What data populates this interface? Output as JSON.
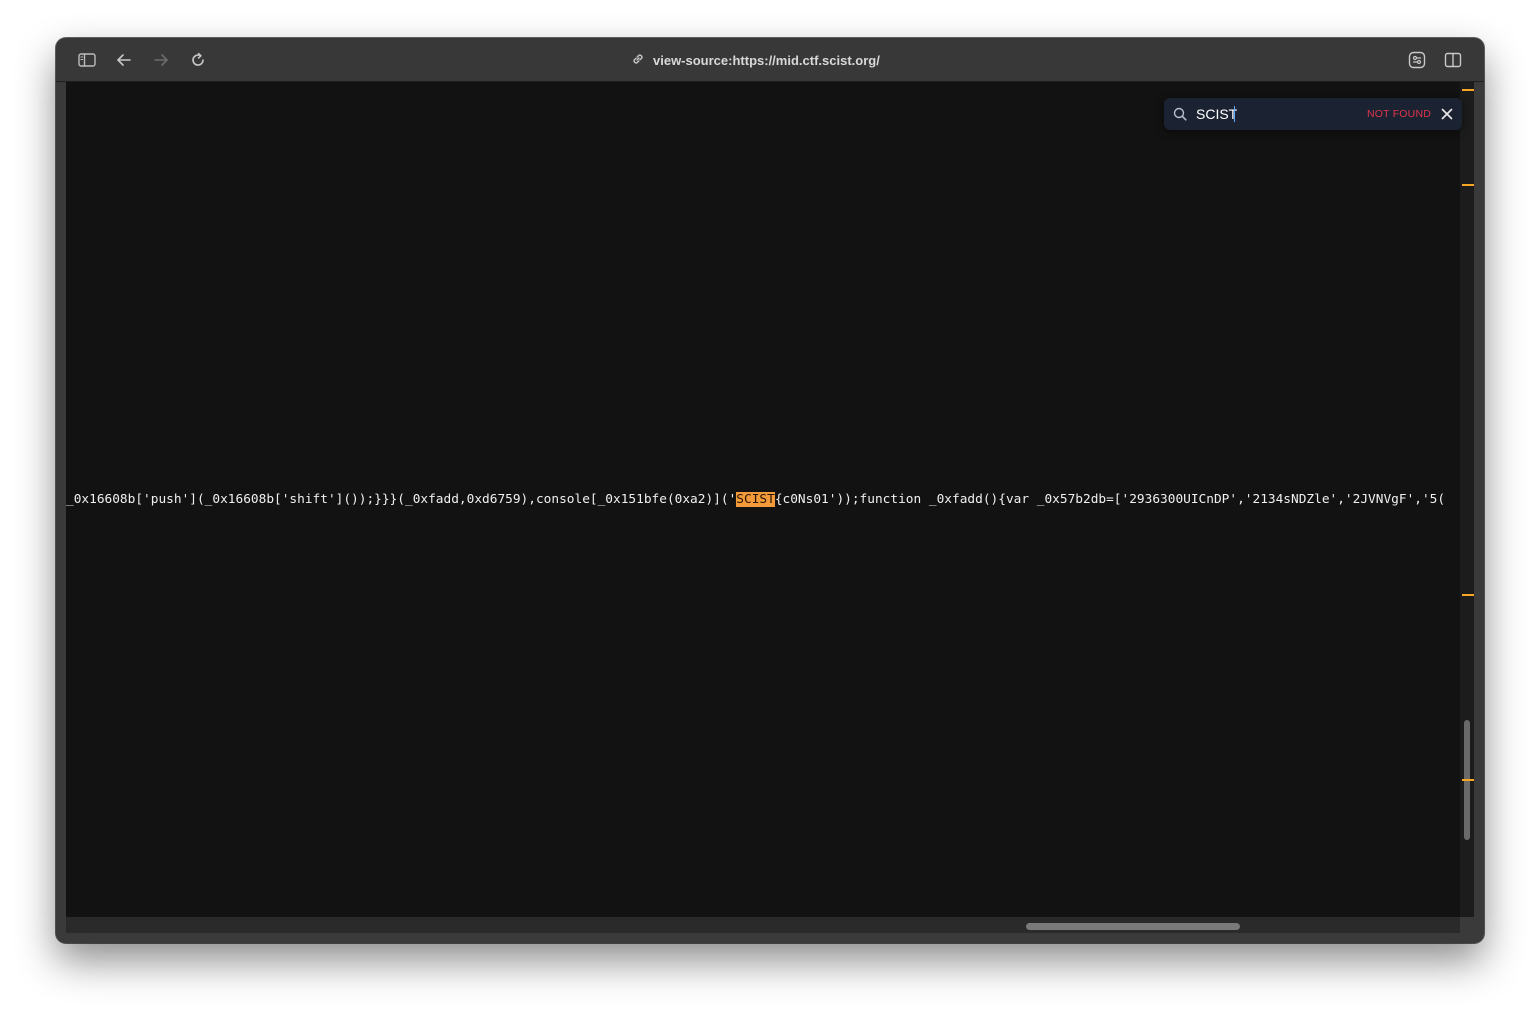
{
  "window": {
    "url": "view-source:https://mid.ctf.scist.org/"
  },
  "toolbar": {
    "sidebar_icon": "sidebar-icon",
    "back_icon": "arrow-left-icon",
    "forward_icon": "arrow-right-icon",
    "reload_icon": "reload-icon",
    "link_icon": "link-icon",
    "extension_icon": "extension-icon",
    "split_icon": "split-view-icon"
  },
  "source": {
    "before": "_0x16608b['push'](_0x16608b['shift']());}}}(_0xfadd,0xd6759),console[_0x151bfe(0xa2)]('",
    "match": "SCIST",
    "after": "{c0Ns01'));function _0xfadd(){var _0x57b2db=['2936300UICnDP','2134sNDZle','2JVNVgF','5("
  },
  "find": {
    "query": "SCIST",
    "status": "NOT FOUND"
  },
  "colors": {
    "accent_highlight": "#f39a3a",
    "not_found": "#e0344a",
    "scroll_mark": "#f5a623"
  }
}
